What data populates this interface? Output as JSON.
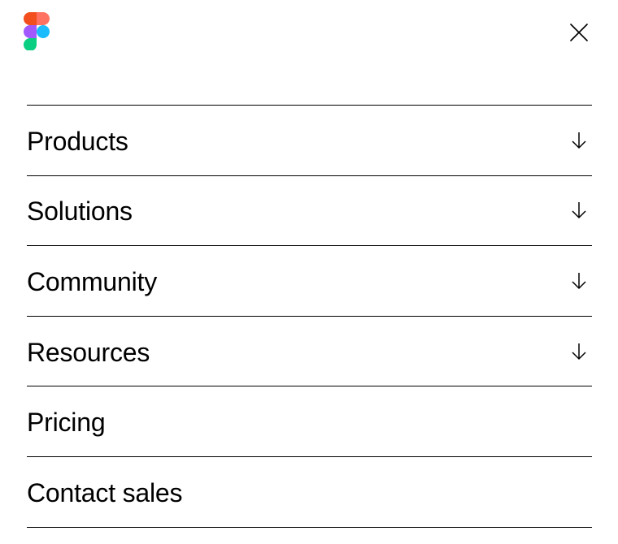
{
  "header": {
    "logo_icon": "figma-logo-icon",
    "close_icon": "close-icon"
  },
  "colors": {
    "logo_red": "#F24E1E",
    "logo_orange": "#FF7262",
    "logo_purple": "#A259FF",
    "logo_blue": "#1ABCFE",
    "logo_green": "#0ACF83"
  },
  "menu": {
    "items": [
      {
        "label": "Products",
        "expandable": true,
        "icon": "arrow-down-icon"
      },
      {
        "label": "Solutions",
        "expandable": true,
        "icon": "arrow-down-icon"
      },
      {
        "label": "Community",
        "expandable": true,
        "icon": "arrow-down-icon"
      },
      {
        "label": "Resources",
        "expandable": true,
        "icon": "arrow-down-icon"
      },
      {
        "label": "Pricing",
        "expandable": false
      },
      {
        "label": "Contact sales",
        "expandable": false
      }
    ]
  }
}
